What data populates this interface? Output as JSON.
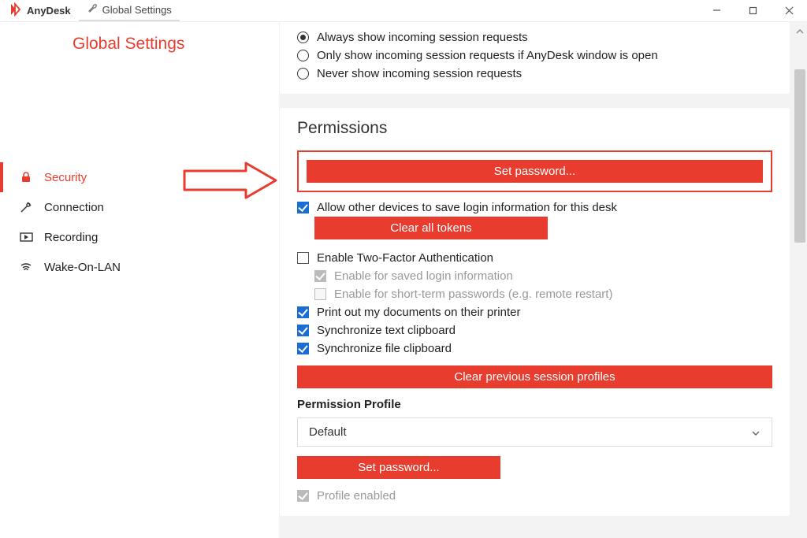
{
  "title_bar": {
    "app_name": "AnyDesk",
    "tab_label": "Global Settings"
  },
  "sidebar": {
    "title": "Global Settings",
    "items": [
      {
        "label": "Security",
        "icon": "lock-icon",
        "active": true
      },
      {
        "label": "Connection",
        "icon": "plug-icon",
        "active": false
      },
      {
        "label": "Recording",
        "icon": "record-icon",
        "active": false
      },
      {
        "label": "Wake-On-LAN",
        "icon": "wifi-icon",
        "active": false
      }
    ]
  },
  "session_requests": {
    "options": [
      {
        "label": "Always show incoming session requests",
        "selected": true
      },
      {
        "label": "Only show incoming session requests if AnyDesk window is open",
        "selected": false
      },
      {
        "label": "Never show incoming session requests",
        "selected": false
      }
    ]
  },
  "permissions": {
    "heading": "Permissions",
    "set_password_btn": "Set password...",
    "allow_save_login": {
      "label": "Allow other devices to save login information for this desk",
      "checked": true
    },
    "clear_tokens_btn": "Clear all tokens",
    "two_factor": {
      "label": "Enable Two-Factor Authentication",
      "checked": false
    },
    "two_factor_saved": {
      "label": "Enable for saved login information",
      "checked": true,
      "disabled": true
    },
    "two_factor_short": {
      "label": "Enable for short-term passwords (e.g. remote restart)",
      "checked": false,
      "disabled": true
    },
    "print_docs": {
      "label": "Print out my documents on their printer",
      "checked": true
    },
    "sync_text": {
      "label": "Synchronize text clipboard",
      "checked": true
    },
    "sync_file": {
      "label": "Synchronize file clipboard",
      "checked": true
    },
    "clear_profiles_btn": "Clear previous session profiles",
    "profile_heading": "Permission Profile",
    "profile_select": {
      "value": "Default"
    },
    "set_password_btn2": "Set password...",
    "profile_enabled": {
      "label": "Profile enabled",
      "checked": true,
      "disabled": true
    }
  },
  "colors": {
    "accent": "#e83c2e",
    "check": "#1a6dd6"
  }
}
